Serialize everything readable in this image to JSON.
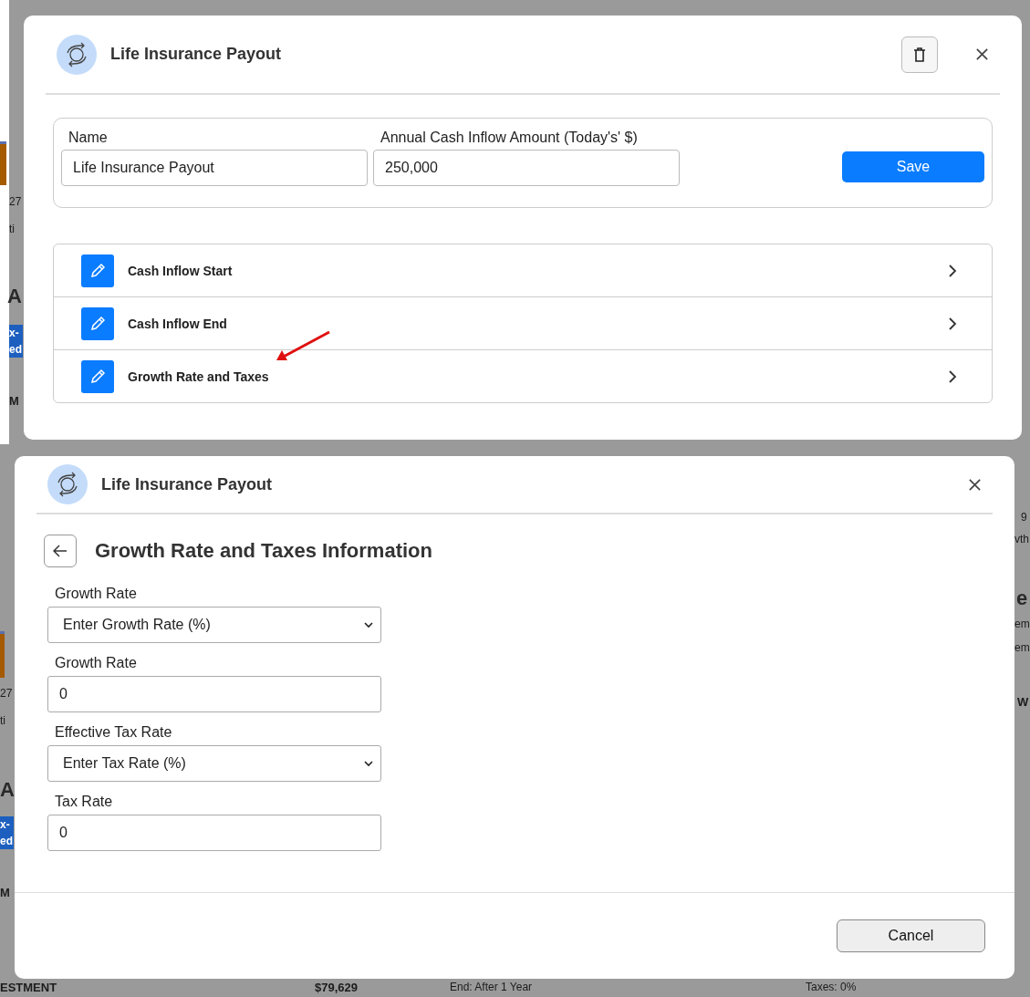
{
  "top_screen": {
    "background_texts": [
      {
        "text": "27",
        "kind": "text"
      },
      {
        "text": "ti",
        "kind": "text"
      },
      {
        "text": "A",
        "kind": "heading"
      },
      {
        "text": "x-\ned",
        "kind": "badge"
      },
      {
        "text": "M",
        "kind": "bold"
      }
    ],
    "dialog": {
      "title": "Life Insurance Payout",
      "fields": [
        {
          "label": "Name",
          "value": "Life Insurance Payout"
        },
        {
          "label": "Annual Cash Inflow Amount (Today's' $)",
          "value": "250,000"
        }
      ],
      "save_button": "Save",
      "sections": [
        {
          "label": "Cash Inflow Start",
          "pointed_at": false
        },
        {
          "label": "Cash Inflow End",
          "pointed_at": false
        },
        {
          "label": "Growth Rate and Taxes",
          "pointed_at": true
        }
      ]
    }
  },
  "bottom_screen": {
    "background_texts": [
      {
        "text": "27",
        "kind": "text"
      },
      {
        "text": "ti",
        "kind": "text"
      },
      {
        "text": "A",
        "kind": "heading"
      },
      {
        "text": "x-\ned",
        "kind": "badge"
      },
      {
        "text": "M",
        "kind": "bold"
      },
      {
        "text": "9",
        "kind": "text"
      },
      {
        "text": "vth",
        "kind": "text"
      },
      {
        "text": "e",
        "kind": "heading"
      },
      {
        "text": "em",
        "kind": "text"
      },
      {
        "text": "em",
        "kind": "text"
      },
      {
        "text": "W",
        "kind": "bold"
      },
      {
        "text": "ESTMENT",
        "kind": "bold"
      },
      {
        "text": "$79,629",
        "kind": "bold"
      },
      {
        "text": "End: After 1 Year",
        "kind": "text"
      },
      {
        "text": "Taxes: 0%",
        "kind": "text"
      }
    ],
    "dialog": {
      "title": "Life Insurance Payout",
      "heading": "Growth Rate and Taxes Information",
      "fields": [
        {
          "kind": "select",
          "label": "Growth Rate",
          "value": "Enter Growth Rate (%)"
        },
        {
          "kind": "input",
          "label": "Growth Rate",
          "value": "0"
        },
        {
          "kind": "select",
          "label": "Effective Tax Rate",
          "value": "Enter Tax Rate (%)"
        },
        {
          "kind": "input",
          "label": "Tax Rate",
          "value": "0"
        }
      ],
      "cancel_button": "Cancel"
    }
  }
}
